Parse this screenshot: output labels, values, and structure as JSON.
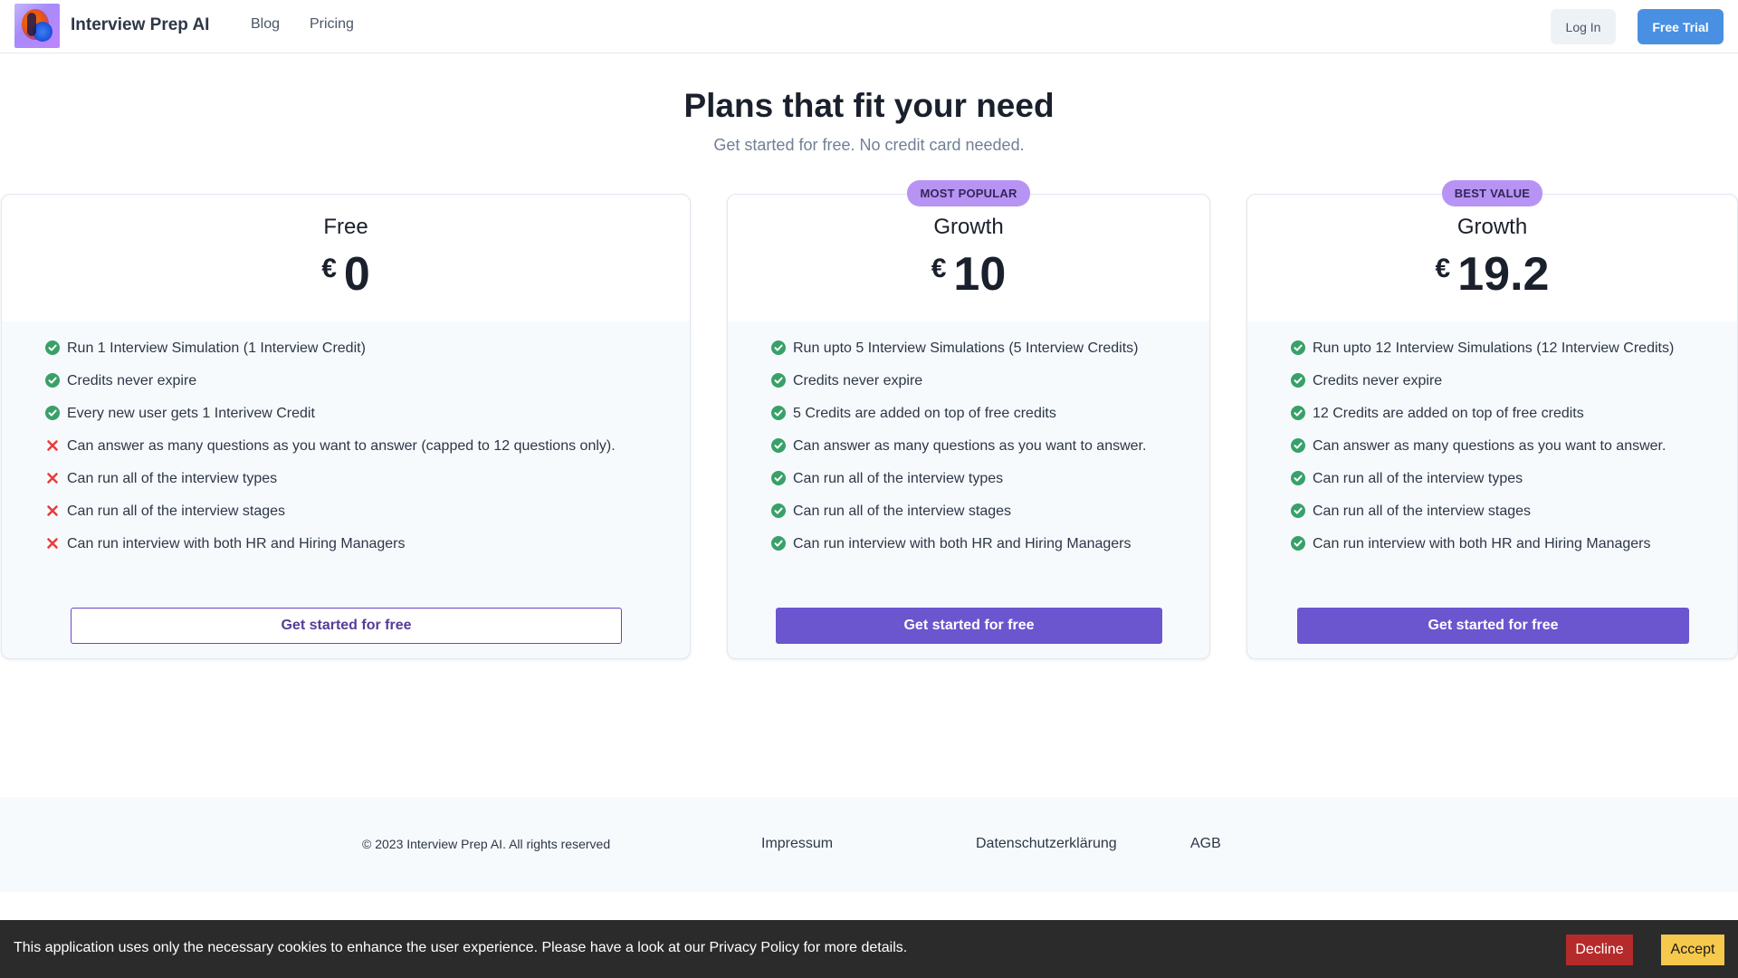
{
  "nav": {
    "brand": "Interview Prep AI",
    "links": [
      "Blog",
      "Pricing"
    ],
    "login_label": "Log In",
    "trial_label": "Free Trial"
  },
  "hero": {
    "title": "Plans that fit your need",
    "subtitle": "Get started for free. No credit card needed."
  },
  "plans": [
    {
      "badge": "",
      "name": "Free",
      "currency": "€",
      "price": "0",
      "features": [
        {
          "text": "Run 1 Interview Simulation (1 Interview Credit)",
          "included": true
        },
        {
          "text": "Credits never expire",
          "included": true
        },
        {
          "text": "Every new user gets 1 Interivew Credit",
          "included": true
        },
        {
          "text": "Can answer as many questions as you want to answer (capped to 12 questions only).",
          "included": false
        },
        {
          "text": "Can run all of the interview types",
          "included": false
        },
        {
          "text": "Can run all of the interview stages",
          "included": false
        },
        {
          "text": "Can run interview with both HR and Hiring Managers",
          "included": false
        }
      ],
      "cta": "Get started for free"
    },
    {
      "badge": "MOST POPULAR",
      "name": "Growth",
      "currency": "€",
      "price": "10",
      "features": [
        {
          "text": "Run upto 5 Interview Simulations (5 Interview Credits)",
          "included": true
        },
        {
          "text": "Credits never expire",
          "included": true
        },
        {
          "text": "5 Credits are added on top of free credits",
          "included": true
        },
        {
          "text": "Can answer as many questions as you want to answer.",
          "included": true
        },
        {
          "text": "Can run all of the interview types",
          "included": true
        },
        {
          "text": "Can run all of the interview stages",
          "included": true
        },
        {
          "text": "Can run interview with both HR and Hiring Managers",
          "included": true
        }
      ],
      "cta": "Get started for free"
    },
    {
      "badge": "BEST VALUE",
      "name": "Growth",
      "currency": "€",
      "price": "19.2",
      "features": [
        {
          "text": "Run upto 12 Interview Simulations (12 Interview Credits)",
          "included": true
        },
        {
          "text": "Credits never expire",
          "included": true
        },
        {
          "text": "12 Credits are added on top of free credits",
          "included": true
        },
        {
          "text": "Can answer as many questions as you want to answer.",
          "included": true
        },
        {
          "text": "Can run all of the interview types",
          "included": true
        },
        {
          "text": "Can run all of the interview stages",
          "included": true
        },
        {
          "text": "Can run interview with both HR and Hiring Managers",
          "included": true
        }
      ],
      "cta": "Get started for free"
    }
  ],
  "footer": {
    "copyright": "© 2023 Interview Prep AI. All rights reserved",
    "links": [
      "Impressum",
      "Datenschutzerklärung",
      "AGB"
    ]
  },
  "cookie": {
    "text": "This application uses only the necessary cookies to enhance the user experience. Please have a look at our Privacy Policy for more details.",
    "decline_label": "Decline",
    "accept_label": "Accept"
  },
  "colors": {
    "check": "#38a169",
    "cross": "#e53e3e",
    "primary": "#6b56cf",
    "badge": "#b794f4",
    "trial": "#4a90e2"
  }
}
